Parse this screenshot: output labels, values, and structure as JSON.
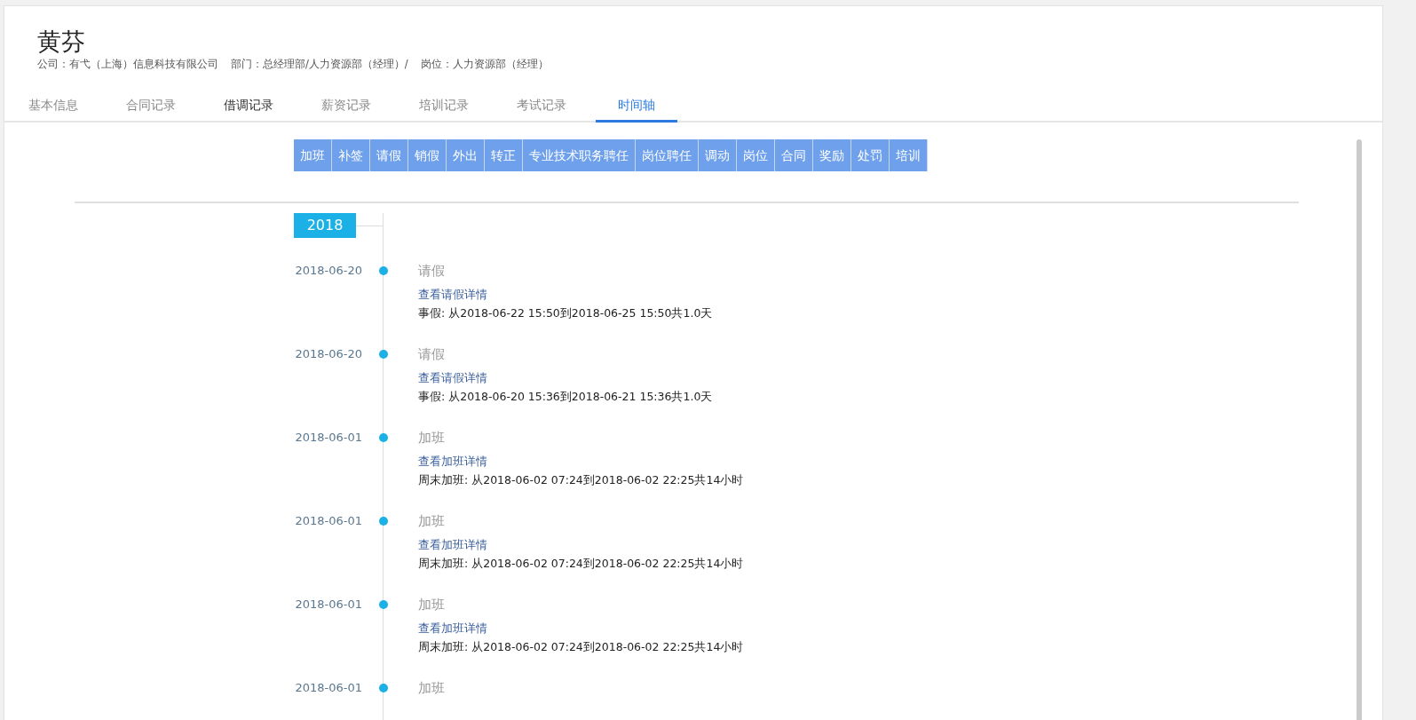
{
  "employee": {
    "name": "黄芬",
    "company": "公司：有弋（上海）信息科技有限公司",
    "department": "部门：总经理部/人力资源部（经理）/",
    "position": "岗位：人力资源部（经理）"
  },
  "tabs": [
    {
      "label": "基本信息",
      "selected": false,
      "hovered": false
    },
    {
      "label": "合同记录",
      "selected": false,
      "hovered": false
    },
    {
      "label": "借调记录",
      "selected": false,
      "hovered": true
    },
    {
      "label": "薪资记录",
      "selected": false,
      "hovered": false
    },
    {
      "label": "培训记录",
      "selected": false,
      "hovered": false
    },
    {
      "label": "考试记录",
      "selected": false,
      "hovered": false
    },
    {
      "label": "时间轴",
      "selected": true,
      "hovered": false
    }
  ],
  "filters": [
    "加班",
    "补签",
    "请假",
    "销假",
    "外出",
    "转正",
    "专业技术职务聘任",
    "岗位聘任",
    "调动",
    "岗位",
    "合同",
    "奖励",
    "处罚",
    "培训"
  ],
  "timeline": {
    "year": "2018",
    "events": [
      {
        "date": "2018-06-20",
        "type": "请假",
        "link": "查看请假详情",
        "detail": "事假: 从2018-06-22 15:50到2018-06-25 15:50共1.0天"
      },
      {
        "date": "2018-06-20",
        "type": "请假",
        "link": "查看请假详情",
        "detail": "事假: 从2018-06-20 15:36到2018-06-21 15:36共1.0天"
      },
      {
        "date": "2018-06-01",
        "type": "加班",
        "link": "查看加班详情",
        "detail": "周末加班: 从2018-06-02 07:24到2018-06-02 22:25共14小时"
      },
      {
        "date": "2018-06-01",
        "type": "加班",
        "link": "查看加班详情",
        "detail": "周末加班: 从2018-06-02 07:24到2018-06-02 22:25共14小时"
      },
      {
        "date": "2018-06-01",
        "type": "加班",
        "link": "查看加班详情",
        "detail": "周末加班: 从2018-06-02 07:24到2018-06-02 22:25共14小时"
      },
      {
        "date": "2018-06-01",
        "type": "加班"
      }
    ]
  }
}
